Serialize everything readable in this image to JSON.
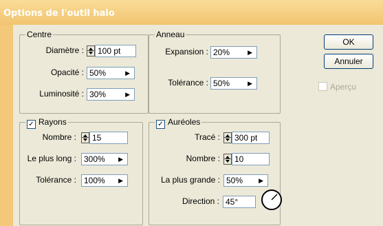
{
  "dialog": {
    "title": "Options de l'outil halo"
  },
  "centre": {
    "legend": "Centre",
    "diametre_label": "Diamètre :",
    "diametre_value": "100 pt",
    "opacite_label": "Opacité :",
    "opacite_value": "50%",
    "luminosite_label": "Luminosité :",
    "luminosite_value": "30%"
  },
  "anneau": {
    "legend": "Anneau",
    "expansion_label": "Expansion :",
    "expansion_value": "20%",
    "tolerance_label": "Tolérance :",
    "tolerance_value": "50%"
  },
  "rayons": {
    "legend": "Rayons",
    "checked": "✓",
    "nombre_label": "Nombre :",
    "nombre_value": "15",
    "plus_long_label": "Le plus long :",
    "plus_long_value": "300%",
    "tolerance_label": "Tolérance :",
    "tolerance_value": "100%"
  },
  "aureoles": {
    "legend": "Auréoles",
    "checked": "✓",
    "trace_label": "Tracé :",
    "trace_value": "300 pt",
    "nombre_label": "Nombre :",
    "nombre_value": "10",
    "plus_grande_label": "La plus grande :",
    "plus_grande_value": "50%",
    "direction_label": "Direction :",
    "direction_value": "45°"
  },
  "buttons": {
    "ok": "OK",
    "annuler": "Annuler"
  },
  "apercu": {
    "label": "Aperçu",
    "checked": false
  },
  "icons": {
    "dropdown": "triangle-right-icon",
    "spinner": "up-down-arrows-icon",
    "direction_dial": "angle-dial-icon"
  },
  "colors": {
    "title_bar": "#f3c878",
    "dialog_bg": "#ece9d8",
    "field_border": "#7f9db9"
  }
}
